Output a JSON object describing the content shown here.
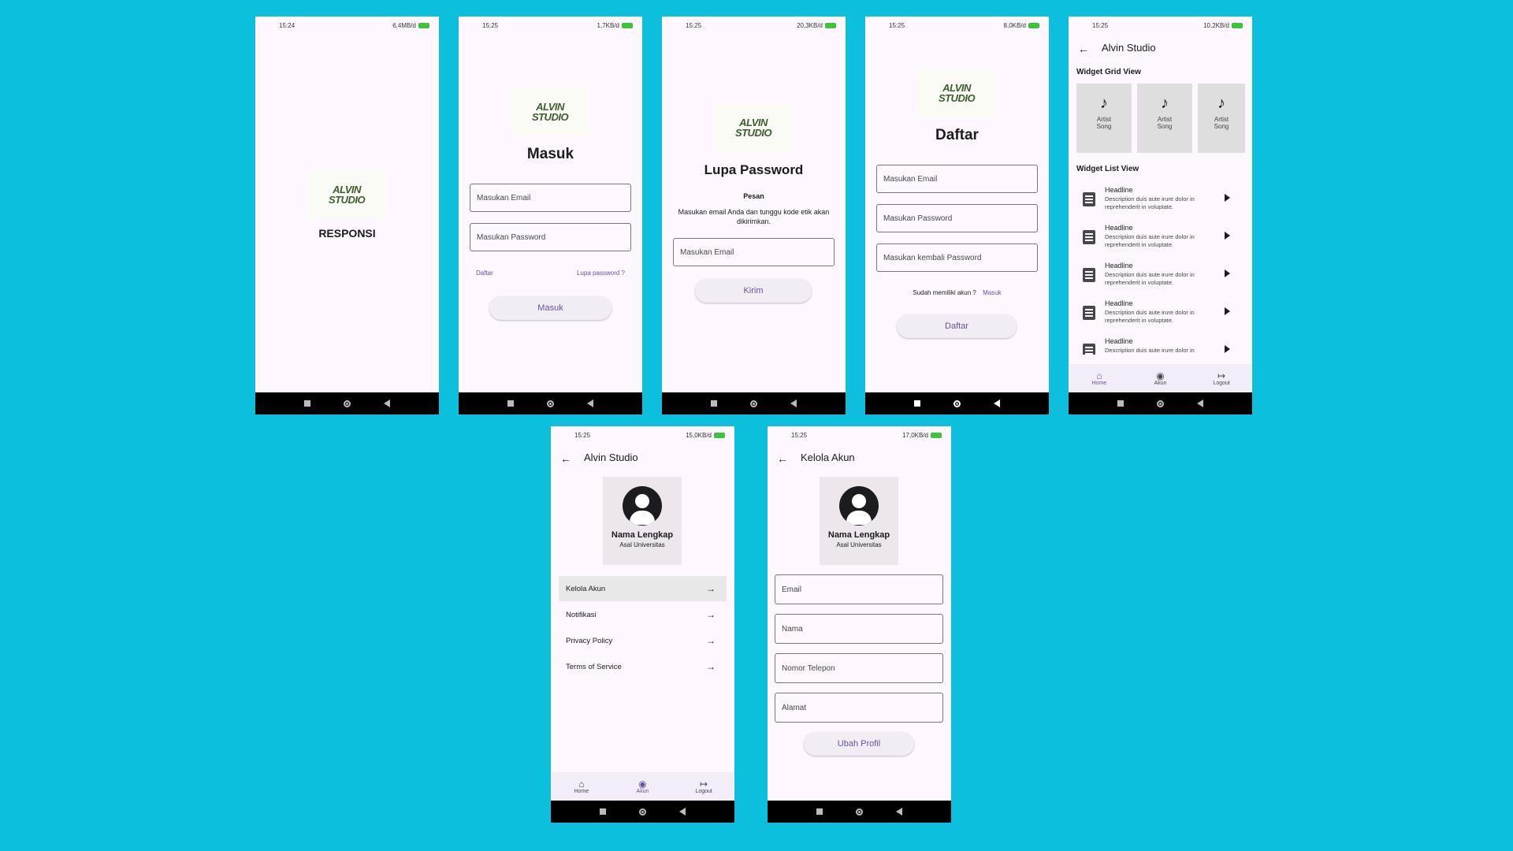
{
  "colors": {
    "background": "#0BBFDD",
    "accent": "#6750A4",
    "screen": "#FEF7FF"
  },
  "logo": {
    "line1": "ALVIN",
    "line2": "STUDIO"
  },
  "nav_buttons": {
    "recent": "square-icon",
    "home": "circle-icon",
    "back": "triangle-back-icon"
  },
  "s1": {
    "status_time": "15:24",
    "status_right": "6,4MB/d",
    "title": "RESPONSI"
  },
  "s2": {
    "status_time": "15:25",
    "status_right": "1,7KB/d",
    "title": "Masuk",
    "email_ph": "Masukan Email",
    "password_ph": "Masukan Password",
    "register_link": "Daftar",
    "forgot_link": "Lupa password ?",
    "button": "Masuk"
  },
  "s3": {
    "status_time": "15:25",
    "status_right": "20,3KB/d",
    "title": "Lupa Password",
    "subtitle": "Pesan",
    "message": "Masukan email Anda dan tunggu kode etik akan dikirimkan.",
    "email_ph": "Masukan Email",
    "button": "Kirim"
  },
  "s4": {
    "status_time": "15:25",
    "status_right": "8,0KB/d",
    "title": "Daftar",
    "email_ph": "Masukan Email",
    "password_ph": "Masukan Password",
    "repassword_ph": "Masukan kembali Password",
    "have_account": "Sudah memiliki akun ?",
    "login_link": "Masuk",
    "button": "Daftar"
  },
  "s5": {
    "status_time": "15:25",
    "status_right": "10,2KB/d",
    "app_title": "Alvin Studio",
    "grid_title": "Widget Grid View",
    "grid_items": [
      {
        "artist": "Artist",
        "song": "Song"
      },
      {
        "artist": "Artist",
        "song": "Song"
      },
      {
        "artist": "Artist",
        "song": "Song"
      }
    ],
    "list_title": "Widget List View",
    "list_items": [
      {
        "headline": "Headline",
        "desc": "Description duis aute irure dolor in reprehenderit in voluptate."
      },
      {
        "headline": "Headline",
        "desc": "Description duis aute irure dolor in reprehenderit in voluptate."
      },
      {
        "headline": "Headline",
        "desc": "Description duis aute irure dolor in reprehenderit in voluptate."
      },
      {
        "headline": "Headline",
        "desc": "Description duis aute irure dolor in reprehenderit in voluptate."
      },
      {
        "headline": "Headline",
        "desc": "Description duis aute irure dolor in"
      }
    ],
    "nav": {
      "home": "Home",
      "akun": "Akun",
      "logout": "Logout"
    }
  },
  "s6": {
    "status_time": "15:25",
    "status_right": "15,0KB/d",
    "app_title": "Alvin Studio",
    "name": "Nama Lengkap",
    "university": "Asal Universitas",
    "menu": [
      "Kelola Akun",
      "Notifikasi",
      "Privacy Policy",
      "Terms of Service"
    ],
    "nav": {
      "home": "Home",
      "akun": "Akun",
      "logout": "Logout"
    }
  },
  "s7": {
    "status_time": "15:25",
    "status_right": "17,0KB/d",
    "app_title": "Kelola Akun",
    "name": "Nama Lengkap",
    "university": "Asal Universitas",
    "fields": [
      "Email",
      "Nama",
      "Nomor Telepon",
      "Alamat"
    ],
    "button": "Ubah Profil"
  }
}
